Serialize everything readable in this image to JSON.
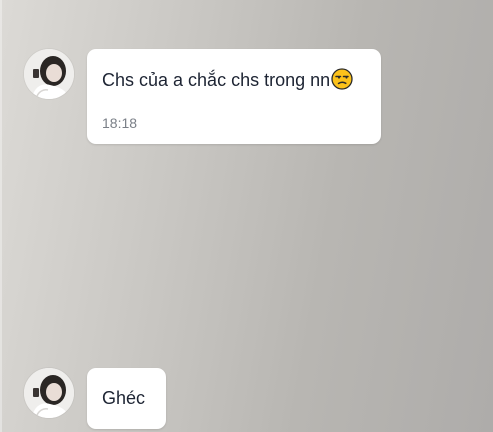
{
  "messages": [
    {
      "text": "Chs của a chắc chs trong nn",
      "emoji": "unamused-face-icon",
      "time": "18:18"
    },
    {
      "text": "Ghéc"
    }
  ],
  "colors": {
    "bubble_bg": "#ffffff",
    "text": "#1d2433",
    "time": "#7a7f87"
  }
}
